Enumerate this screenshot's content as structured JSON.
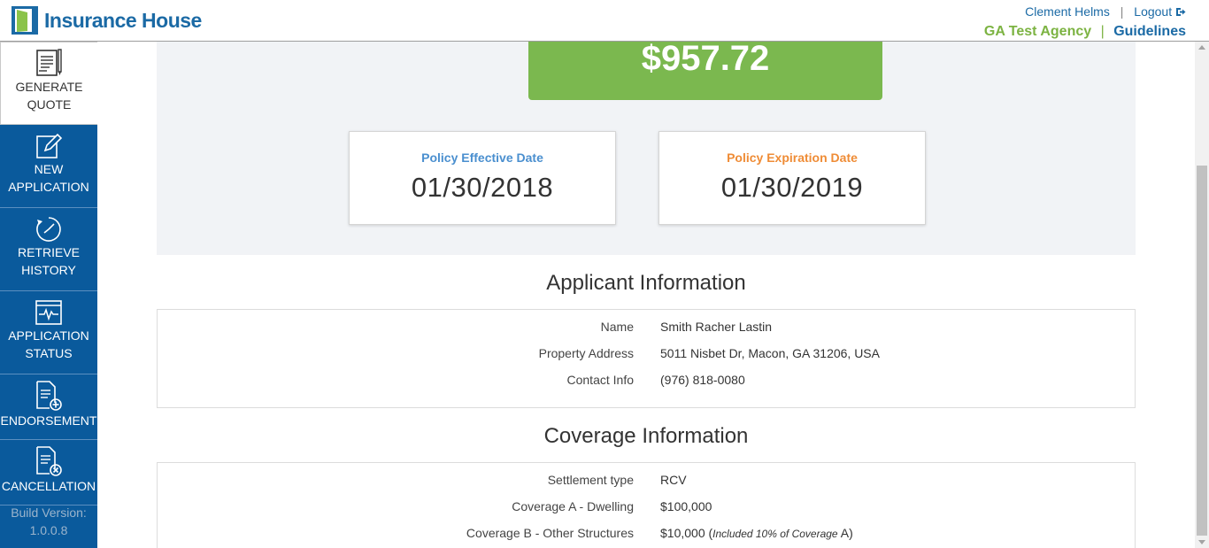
{
  "header": {
    "brand": "Insurance House",
    "user_name": "Clement Helms",
    "separator": "|",
    "logout_label": "Logout",
    "agency": "GA Test Agency",
    "guidelines_label": "Guidelines"
  },
  "sidebar": {
    "items": [
      {
        "line1": "GENERATE",
        "line2": "QUOTE",
        "icon": "document-list-icon"
      },
      {
        "line1": "NEW",
        "line2": "APPLICATION",
        "icon": "edit-icon"
      },
      {
        "line1": "RETRIEVE",
        "line2": "HISTORY",
        "icon": "history-icon"
      },
      {
        "line1": "APPLICATION",
        "line2": "STATUS",
        "icon": "status-monitor-icon"
      },
      {
        "line1": "ENDORSEMENT",
        "line2": "",
        "icon": "doc-add-icon"
      },
      {
        "line1": "CANCELLATION",
        "line2": "",
        "icon": "doc-cancel-icon"
      }
    ],
    "build_label": "Build Version:",
    "build_version": "1.0.0.8"
  },
  "quote": {
    "premium": "$957.72",
    "effective_label": "Policy Effective Date",
    "effective_date": "01/30/2018",
    "expiration_label": "Policy Expiration Date",
    "expiration_date": "01/30/2019"
  },
  "applicant": {
    "title": "Applicant Information",
    "rows": [
      {
        "label": "Name",
        "value": "Smith Racher Lastin"
      },
      {
        "label": "Property Address",
        "value": "5011 Nisbet Dr, Macon, GA 31206, USA"
      },
      {
        "label": "Contact Info",
        "value": "(976) 818-0080"
      }
    ]
  },
  "coverage": {
    "title": "Coverage Information",
    "rows": [
      {
        "label": "Settlement type",
        "value": "RCV",
        "note": ""
      },
      {
        "label": "Coverage A - Dwelling",
        "value": "$100,000",
        "note": ""
      },
      {
        "label": "Coverage B - Other Structures",
        "value": "$10,000",
        "note_open": "(",
        "note": "Included 10% of Coverage",
        "note_tail": "A)"
      }
    ]
  },
  "colors": {
    "brand_blue": "#1b6aa5",
    "sidebar_blue": "#0a5a9c",
    "premium_green": "#7bb84f",
    "agency_green": "#7cb342",
    "effective_blue": "#4a8fcf",
    "expiration_orange": "#ef8c36"
  }
}
